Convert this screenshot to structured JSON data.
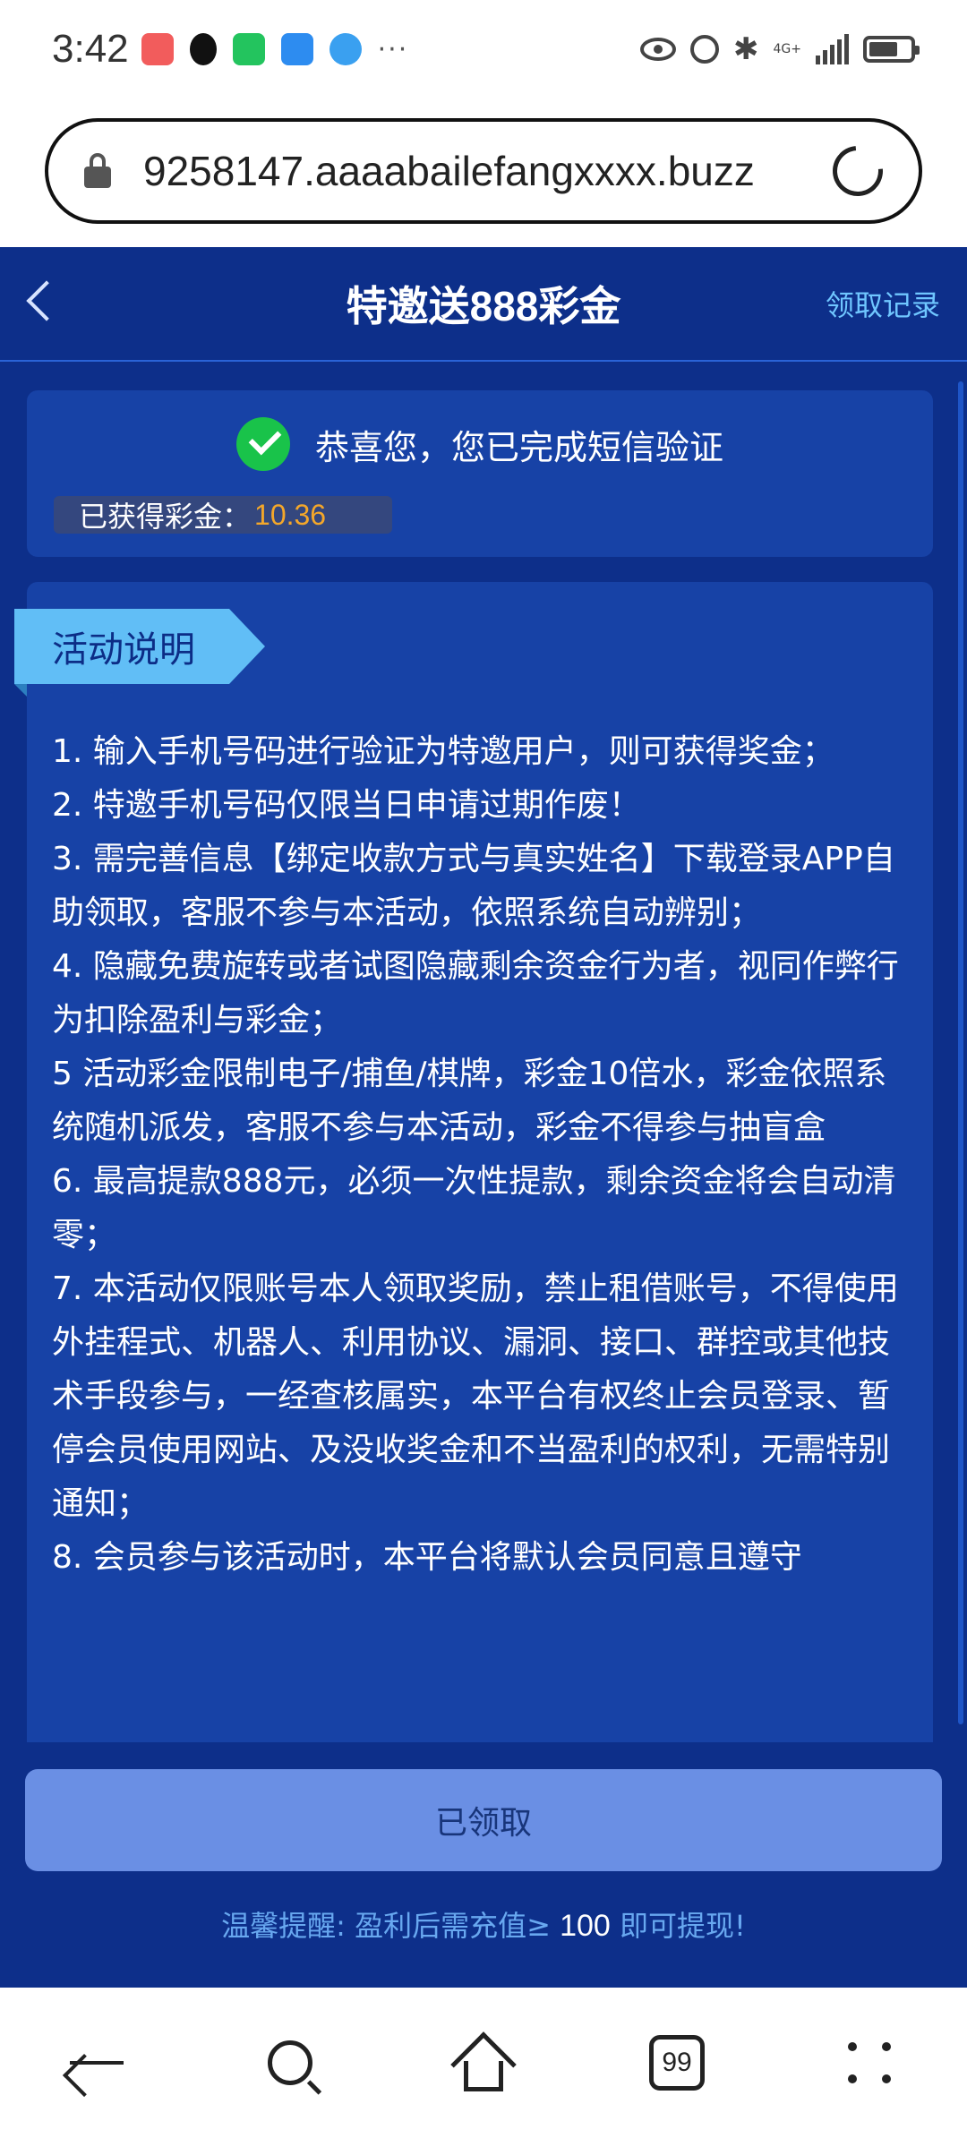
{
  "status_bar": {
    "time": "3:42",
    "more": "···",
    "network": "4G+"
  },
  "browser": {
    "url": "9258147.aaaabailefangxxxx.buzz",
    "tab_count": "99"
  },
  "header": {
    "title": "特邀送888彩金",
    "records_link": "领取记录"
  },
  "success": {
    "message": "恭喜您，您已完成短信验证",
    "earned_label": "已获得彩金：",
    "earned_value": "10.36"
  },
  "rules": {
    "tag": "活动说明",
    "items": [
      "1.  输入手机号码进行验证为特邀用户，则可获得奖金；",
      "2.  特邀手机号码仅限当日申请过期作废！",
      "3.  需完善信息【绑定收款方式与真实姓名】下载登录APP自助领取，客服不参与本活动，依照系统自动辨别；",
      "4.  隐藏免费旋转或者试图隐藏剩余资金行为者，视同作弊行为扣除盈利与彩金；",
      "5  活动彩金限制电子/捕鱼/棋牌，彩金10倍水，彩金依照系统随机派发，客服不参与本活动，彩金不得参与抽盲盒",
      "6.  最高提款888元，必须一次性提款，剩余资金将会自动清零；",
      "7.  本活动仅限账号本人领取奖励，禁止租借账号，不得使用外挂程式、机器人、利用协议、漏洞、接口、群控或其他技术手段参与，一经查核属实，本平台有权终止会员登录、暂停会员使用网站、及没收奖金和不当盈利的权利，无需特别通知；",
      "8.  会员参与该活动时，本平台将默认会员同意且遵守"
    ]
  },
  "actions": {
    "claimed_button": "已领取",
    "tip_prefix": "温馨提醒: 盈利后需充值≥ ",
    "tip_amount": "100",
    "tip_suffix": " 即可提现!"
  },
  "colors": {
    "page_bg": "#0d2f8a",
    "card_bg": "#1742a6",
    "accent_link": "#6fc6ff",
    "earned_value": "#f4a72a",
    "success_green": "#19c34a",
    "button_bg": "#6a8fe4",
    "tag_bg": "#61bef6"
  }
}
